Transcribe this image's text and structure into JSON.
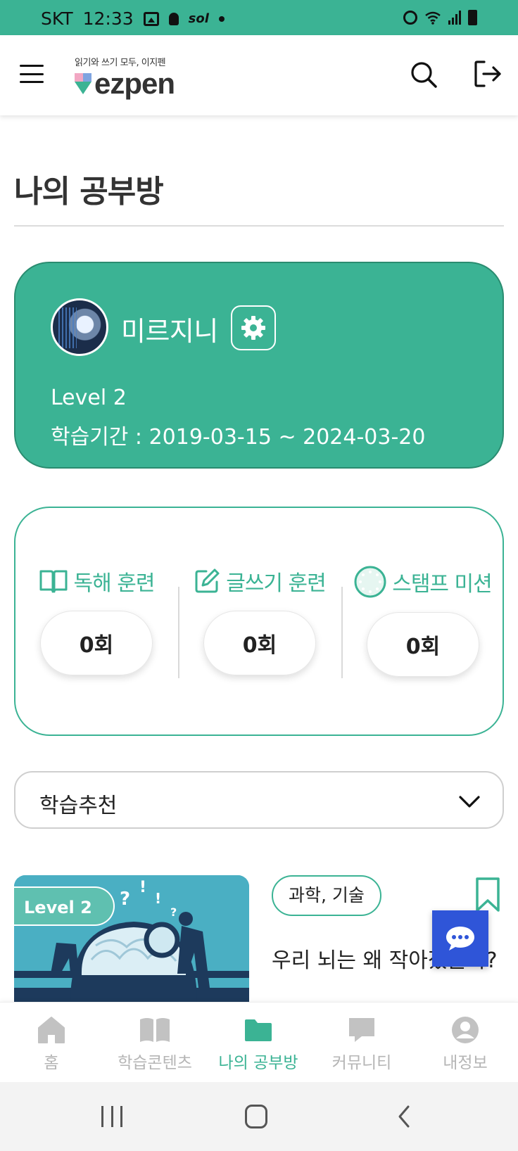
{
  "status_bar": {
    "carrier": "SKT",
    "time": "12:33",
    "sol_label": "sol"
  },
  "header": {
    "logo_tagline": "읽기와 쓰기 모두, 이지펜",
    "logo_word": "ezpen",
    "icons": [
      "menu-icon",
      "search-icon",
      "logout-icon"
    ]
  },
  "page": {
    "title": "나의 공부방"
  },
  "profile": {
    "name": "미르지니",
    "level": "Level 2",
    "period": "학습기간 : 2019-03-15 ~ 2024-03-20"
  },
  "stats": [
    {
      "label": "독해 훈련",
      "icon": "book-icon",
      "value": "0회"
    },
    {
      "label": "글쓰기 훈련",
      "icon": "edit-icon",
      "value": "0회"
    },
    {
      "label": "스탬프 미션",
      "icon": "stamp-icon",
      "value": "0회"
    }
  ],
  "dropdown": {
    "selected": "학습추천"
  },
  "recommendation": {
    "level_badge": "Level 2",
    "tag": "과학, 기술",
    "title": "우리 뇌는 왜 작아졌을까?"
  },
  "bottom_nav": [
    {
      "label": "홈",
      "icon": "home-icon"
    },
    {
      "label": "학습콘텐츠",
      "icon": "book-open-icon"
    },
    {
      "label": "나의 공부방",
      "icon": "folder-icon",
      "active": true
    },
    {
      "label": "커뮤니티",
      "icon": "chat-bubble-icon"
    },
    {
      "label": "내정보",
      "icon": "user-icon"
    }
  ],
  "colors": {
    "brand": "#3bb394",
    "chat_fab": "#2f55d8",
    "inactive": "#b5b5b5"
  }
}
